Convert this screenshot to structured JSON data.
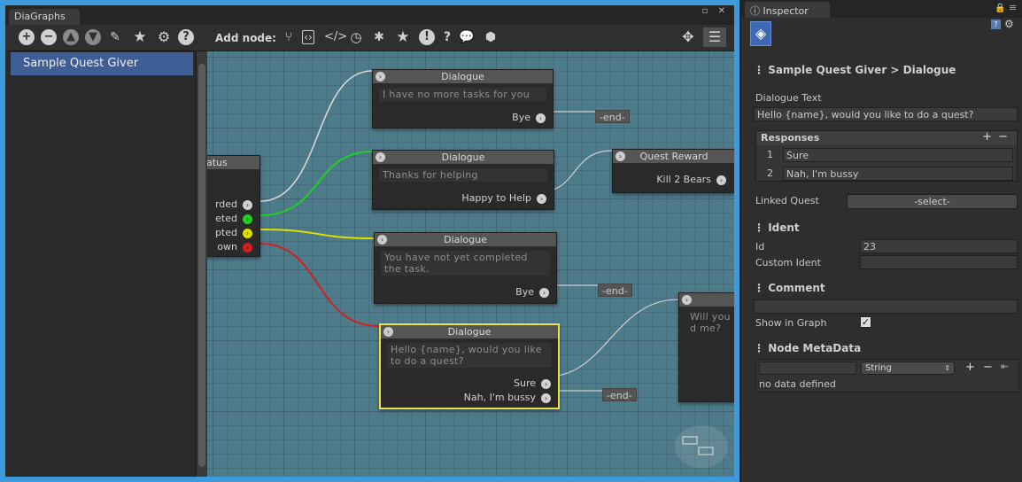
{
  "window": {
    "title": "DiaGraphs",
    "controls": "▫ ✕"
  },
  "toolbar": {
    "add_node_label": "Add node:"
  },
  "sidebar": {
    "items": [
      {
        "label": "Sample Quest Giver"
      }
    ]
  },
  "graph": {
    "status_node": {
      "title": "atus",
      "outputs": [
        "rded",
        "eted",
        "pted",
        "own"
      ]
    },
    "dialogue_title": "Dialogue",
    "nodes": [
      {
        "title": "Dialogue",
        "text": "I have no more tasks for you",
        "outputs": [
          "Bye"
        ]
      },
      {
        "title": "Dialogue",
        "text": "Thanks for helping",
        "outputs": [
          "Happy to Help"
        ]
      },
      {
        "title": "Quest Reward",
        "text": "",
        "outputs": [
          "Kill 2 Bears"
        ]
      },
      {
        "title": "Dialogue",
        "text": "You have not yet completed the task.",
        "outputs": [
          "Bye"
        ]
      },
      {
        "title": "Dialogue",
        "text": "Hello {name}, would you like to do a quest?",
        "outputs": [
          "Sure",
          "Nah, I'm bussy"
        ]
      },
      {
        "title": "",
        "text": "Will you d me?",
        "outputs": []
      }
    ],
    "end_label": "-end-",
    "colors": {
      "completed": "#22d022",
      "accepted": "#e0e000",
      "unknown": "#d02020",
      "selected": "#f0e040"
    }
  },
  "inspector": {
    "tab": "Inspector",
    "title": "Sample Quest Giver > Dialogue",
    "dialogue_text_label": "Dialogue Text",
    "dialogue_text": "Hello {name}, would you like to do a quest?",
    "responses_label": "Responses",
    "responses": [
      {
        "n": "1",
        "text": "Sure"
      },
      {
        "n": "2",
        "text": "Nah, I'm bussy"
      }
    ],
    "linked_quest_label": "Linked Quest",
    "linked_quest_value": "-select-",
    "ident_header": "Ident",
    "id_label": "Id",
    "id_value": "23",
    "custom_ident_label": "Custom Ident",
    "comment_header": "Comment",
    "show_in_graph_label": "Show in Graph",
    "metadata_header": "Node MetaData",
    "metadata_type": "String",
    "no_data": "no data defined"
  }
}
